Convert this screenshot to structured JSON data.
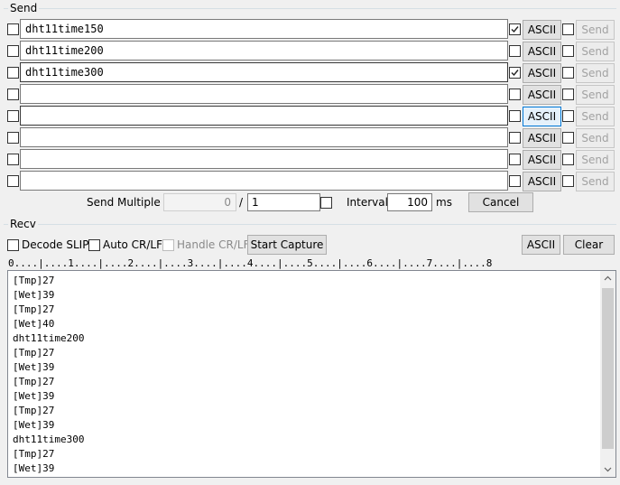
{
  "send_group": {
    "title": "Send",
    "rows": [
      {
        "text": "dht11time150",
        "enabled": false,
        "hex_checked": true,
        "mode": "ASCII",
        "send": "Send",
        "mode_active": false
      },
      {
        "text": "dht11time200",
        "enabled": false,
        "hex_checked": false,
        "mode": "ASCII",
        "send": "Send",
        "mode_active": false
      },
      {
        "text": "dht11time300",
        "enabled": false,
        "hex_checked": true,
        "mode": "ASCII",
        "send": "Send",
        "mode_active": false
      },
      {
        "text": "",
        "enabled": false,
        "hex_checked": false,
        "mode": "ASCII",
        "send": "Send",
        "mode_active": false
      },
      {
        "text": "",
        "enabled": false,
        "hex_checked": false,
        "mode": "ASCII",
        "send": "Send",
        "mode_active": true
      },
      {
        "text": "",
        "enabled": false,
        "hex_checked": false,
        "mode": "ASCII",
        "send": "Send",
        "mode_active": false
      },
      {
        "text": "",
        "enabled": false,
        "hex_checked": false,
        "mode": "ASCII",
        "send": "Send",
        "mode_active": false
      },
      {
        "text": "",
        "enabled": false,
        "hex_checked": false,
        "mode": "ASCII",
        "send": "Send",
        "mode_active": false
      }
    ],
    "send_multiple_label": "Send Multiple :",
    "progress_value": "0",
    "separator": "/",
    "count_value": "1",
    "interval_label": "Interval",
    "interval_value": "100",
    "interval_unit": "ms",
    "cancel_label": "Cancel"
  },
  "recv_group": {
    "title": "Recv",
    "decode_slip_label": "Decode SLIP",
    "auto_crlf_label": "Auto CR/LF",
    "handle_crlf_label": "Handle CR/LF",
    "start_capture_label": "Start Capture",
    "ascii_label": "ASCII",
    "clear_label": "Clear",
    "ruler": "0....|....1....|....2....|....3....|....4....|....5....|....6....|....7....|....8",
    "lines": [
      "[Tmp]27",
      "[Wet]39",
      "[Tmp]27",
      "[Wet]40",
      "dht11time200",
      "[Tmp]27",
      "[Wet]39",
      "[Tmp]27",
      "[Wet]39",
      "[Tmp]27",
      "[Wet]39",
      "dht11time300",
      "[Tmp]27",
      "[Wet]39"
    ]
  },
  "icons": {
    "check": "checkmark-icon",
    "scroll_up": "chevron-up-icon",
    "scroll_down": "chevron-down-icon"
  }
}
